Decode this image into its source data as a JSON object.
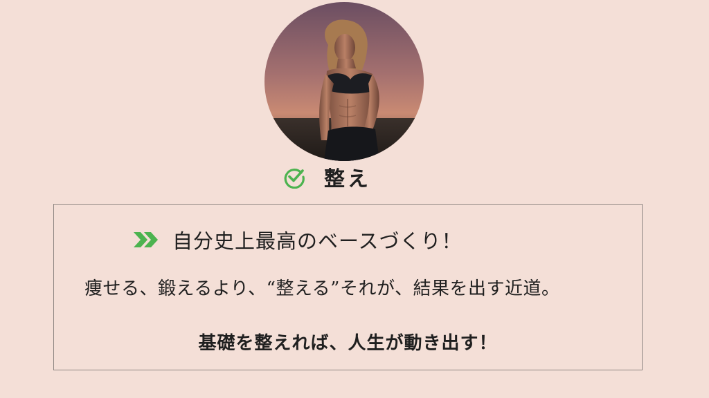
{
  "headline": {
    "icon": "check-circle-icon",
    "text": "整え"
  },
  "card": {
    "title_icon": "double-chevron-right-icon",
    "title": "自分史上最高のベースづくり！",
    "body": "痩せる、鍛えるより、“整える”それが、結果を出す近道。",
    "closing": "基礎を整えれば、人生が動き出す！"
  },
  "colors": {
    "background": "#f4dfd7",
    "accent_green": "#4cb34f",
    "border": "#8c8480"
  }
}
